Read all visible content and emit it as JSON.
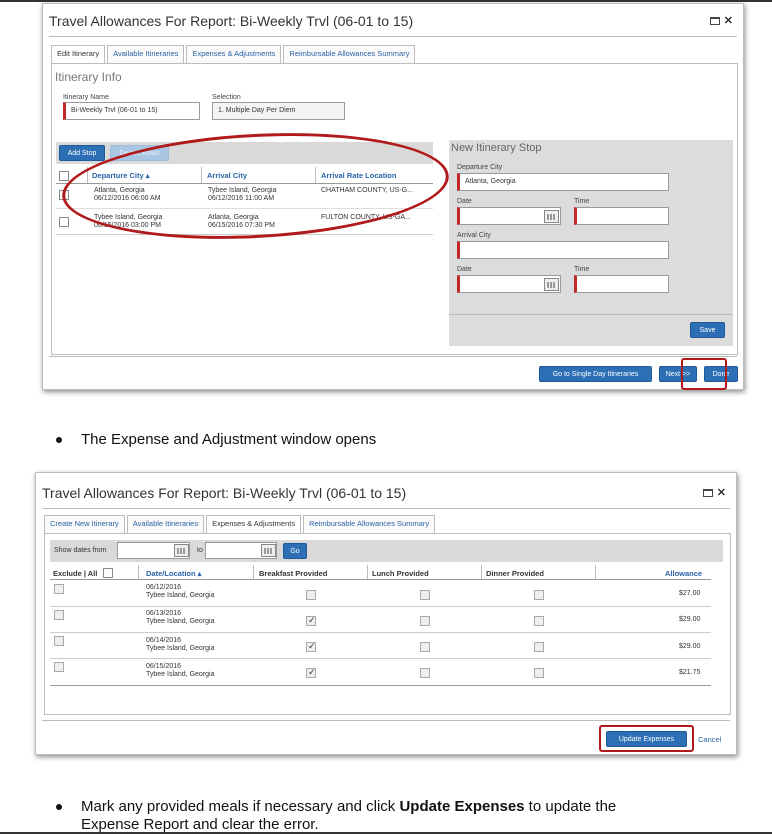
{
  "window1": {
    "title": "Travel Allowances For Report: Bi-Weekly Trvl (06-01 to 15)",
    "tabs": [
      "Edit Itinerary",
      "Available Itineraries",
      "Expenses & Adjustments",
      "Reimbursable Allowances Summary"
    ],
    "section_title": "Itinerary Info",
    "itinerary_name_label": "Itinerary Name",
    "itinerary_name_value": "Bi-Weekly Trvl  (06-01 to 15)",
    "selection_label": "Selection",
    "selection_value": "1. Multiple Day Per Diem",
    "add_stop_label": "Add Stop",
    "delete_rows_label": "Delete Rows",
    "columns": [
      "Departure City ▴",
      "Arrival City",
      "Arrival Rate Location"
    ],
    "rows": [
      {
        "dep_city": "Atlanta, Georgia",
        "dep_dt": "06/12/2016 06:00 AM",
        "arr_city": "Tybee Island, Georgia",
        "arr_dt": "06/12/2016 11:00 AM",
        "rate_loc": "CHATHAM COUNTY, US-G..."
      },
      {
        "dep_city": "Tybee Island, Georgia",
        "dep_dt": "06/15/2016 03:00 PM",
        "arr_city": "Atlanta, Georgia",
        "arr_dt": "06/15/2016 07:30 PM",
        "rate_loc": "FULTON COUNTY, US-GA..."
      }
    ],
    "new_stop": {
      "title": "New Itinerary Stop",
      "departure_city_label": "Departure City",
      "departure_city_value": "Atlanta, Georgia",
      "date_label": "Date",
      "time_label": "Time",
      "arrival_city_label": "Arrival City",
      "date2_label": "Date",
      "time2_label": "Time",
      "save_label": "Save"
    },
    "footer": {
      "single_day_label": "Go to Single Day Itineraries",
      "next_label": "Next >>",
      "done_label": "Done"
    }
  },
  "bullet1": "The Expense and Adjustment window opens",
  "window2": {
    "title": "Travel Allowances For Report: Bi-Weekly Trvl (06-01 to 15)",
    "tabs": [
      "Create New Itinerary",
      "Available Itineraries",
      "Expenses & Adjustments",
      "Reimbursable Allowances Summary"
    ],
    "show_dates_from_label": "Show dates from",
    "to_label": "to",
    "go_label": "Go",
    "columns": [
      "Exclude | All",
      "Date/Location ▴",
      "Breakfast Provided",
      "Lunch Provided",
      "Dinner Provided",
      "Allowance"
    ],
    "rows": [
      {
        "date": "06/12/2016",
        "location": "Tybee Island, Georgia",
        "breakfast": false,
        "allowance": "$27.00"
      },
      {
        "date": "06/13/2016",
        "location": "Tybee Island, Georgia",
        "breakfast": true,
        "allowance": "$29.00"
      },
      {
        "date": "06/14/2016",
        "location": "Tybee Island, Georgia",
        "breakfast": true,
        "allowance": "$29.00"
      },
      {
        "date": "06/15/2016",
        "location": "Tybee Island, Georgia",
        "breakfast": true,
        "allowance": "$21.75"
      }
    ],
    "update_label": "Update Expenses",
    "cancel_label": "Cancel"
  },
  "bullet2": {
    "before": "Mark any provided meals if necessary and click ",
    "bold": "Update Expenses",
    "after": " to update the",
    "line2": "Expense Report and clear the error."
  },
  "colors": {
    "accent_blue": "#2c6fb4",
    "annotation_red": "#b11a1a",
    "required_marker": "#c22a2a"
  }
}
